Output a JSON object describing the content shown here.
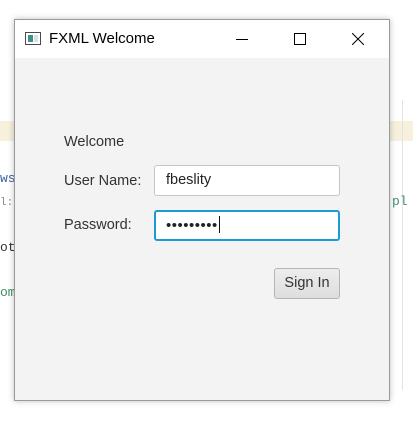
{
  "window": {
    "title": "FXML Welcome",
    "icon": "app-window-icon",
    "controls": {
      "minimize": "minimize-icon",
      "maximize": "maximize-icon",
      "close": "close-icon"
    }
  },
  "form": {
    "heading": "Welcome",
    "username_label": "User Name:",
    "username_value": "fbeslity",
    "password_label": "Password:",
    "password_value": "•••••••••",
    "submit_label": "Sign In"
  },
  "background": {
    "fragments": [
      "ws",
      "l:",
      "ot",
      "om",
      "pl"
    ]
  },
  "colors": {
    "focus_ring": "#1a9ad6",
    "window_bg": "#f3f3f3",
    "titlebar_bg": "#ffffff"
  }
}
